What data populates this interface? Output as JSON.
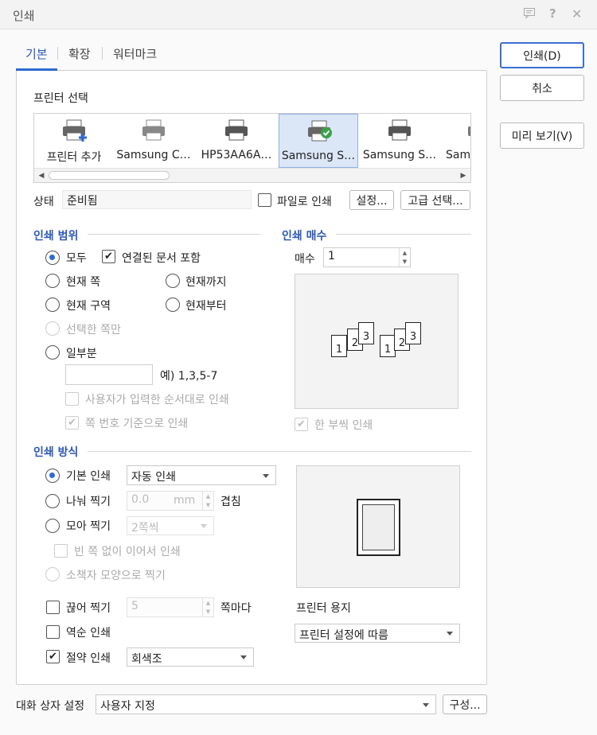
{
  "window": {
    "title": "인쇄",
    "icons": [
      "chat-icon",
      "help-icon",
      "close-icon"
    ]
  },
  "tabs": [
    {
      "label": "기본"
    },
    {
      "label": "확장"
    },
    {
      "label": "워터마크"
    }
  ],
  "buttons": {
    "print": "인쇄(D)",
    "cancel": "취소",
    "preview": "미리 보기(V)",
    "settings": "설정...",
    "advanced": "고급 선택...",
    "configure": "구성..."
  },
  "printer": {
    "section_label": "프린터 선택",
    "items": [
      {
        "name": "프린터 추가",
        "icon": "printer-add-icon"
      },
      {
        "name": "Samsung C…",
        "icon": "printer-icon"
      },
      {
        "name": "HP53AA6A…",
        "icon": "printer-icon"
      },
      {
        "name": "Samsung S…",
        "icon": "printer-default-icon"
      },
      {
        "name": "Samsung S…",
        "icon": "printer-icon"
      },
      {
        "name": "Sams",
        "icon": "printer-icon"
      }
    ],
    "selected_index": 3,
    "status_label": "상태",
    "status_value": "준비됨",
    "print_to_file": "파일로 인쇄"
  },
  "range": {
    "title": "인쇄 범위",
    "all": "모두",
    "include_linked": "연결된 문서 포함",
    "current_page": "현재 쪽",
    "to_current": "현재까지",
    "current_section": "현재 구역",
    "from_current": "현재부터",
    "selection_only": "선택한 쪽만",
    "partial": "일부분",
    "partial_value": "",
    "example": "예) 1,3,5-7",
    "user_order": "사용자가 입력한 순서대로 인쇄",
    "page_number_basis": "쪽 번호 기준으로 인쇄"
  },
  "copies": {
    "title": "인쇄 매수",
    "label": "매수",
    "value": "1",
    "collate": "한 부씩 인쇄"
  },
  "method": {
    "title": "인쇄 방식",
    "basic": "기본 인쇄",
    "basic_value": "자동 인쇄",
    "split": "나눠 찍기",
    "split_value": "0.0",
    "split_unit": "mm",
    "overlap": "겹침",
    "gather": "모아 찍기",
    "gather_value": "2쪽씩",
    "no_blank": "빈 쪽 없이 이어서 인쇄",
    "booklet": "소책자 모양으로 찍기",
    "break": "끊어 찍기",
    "break_value": "5",
    "per_pages": "쪽마다",
    "reverse": "역순 인쇄",
    "eco": "절약 인쇄",
    "eco_value": "회색조"
  },
  "paper": {
    "title": "프린터 용지",
    "value": "프린터 설정에 따름"
  },
  "dialog": {
    "label": "대화 상자 설정",
    "value": "사용자 지정"
  }
}
